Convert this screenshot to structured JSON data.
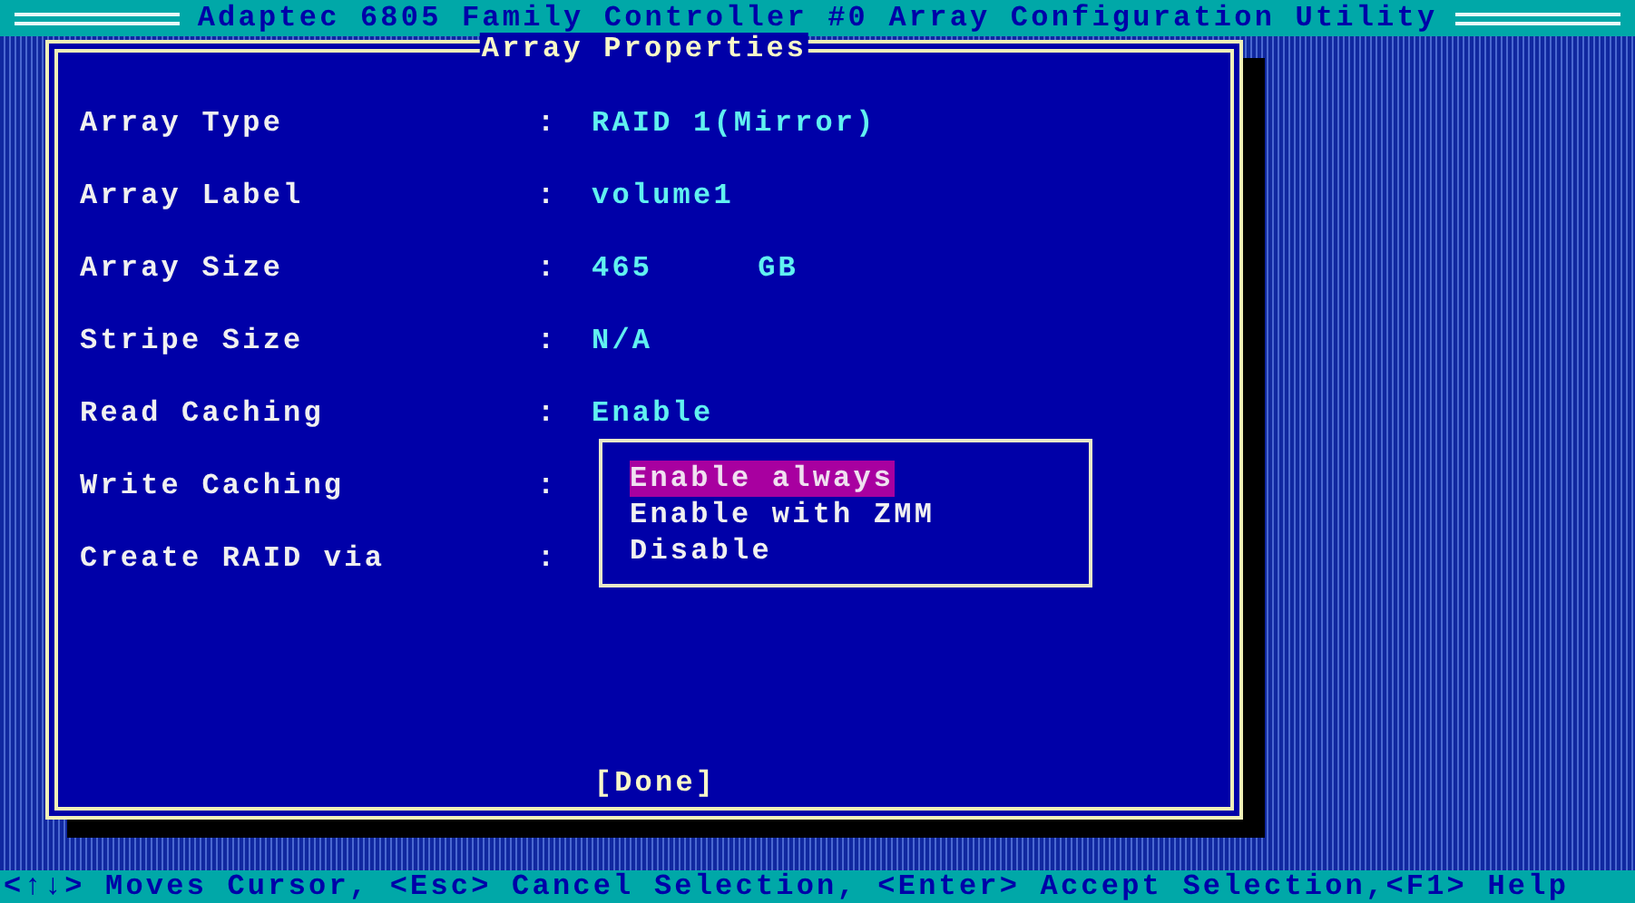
{
  "window": {
    "title": "Adaptec 6805 Family Controller #0 Array Configuration Utility"
  },
  "panel": {
    "title": "Array Properties",
    "fields": [
      {
        "label": "Array Type",
        "separator": ":",
        "value": "RAID 1(Mirror)"
      },
      {
        "label": "Array Label",
        "separator": ":",
        "value": "volume1"
      },
      {
        "label": "Array Size",
        "separator": ":",
        "value": "465",
        "unit": "GB"
      },
      {
        "label": "Stripe Size",
        "separator": ":",
        "value": "N/A"
      },
      {
        "label": "Read Caching",
        "separator": ":",
        "value": "Enable"
      },
      {
        "label": "Write Caching",
        "separator": ":"
      },
      {
        "label": "Create RAID via",
        "separator": ":"
      }
    ],
    "dropdown": {
      "options": [
        {
          "label": "Enable always",
          "selected": true
        },
        {
          "label": "Enable with ZMM",
          "selected": false
        },
        {
          "label": "Disable",
          "selected": false
        }
      ]
    },
    "done_button": "[Done]"
  },
  "status_bar": "<↑↓> Moves Cursor, <Esc> Cancel Selection, <Enter> Accept Selection,<F1> Help"
}
